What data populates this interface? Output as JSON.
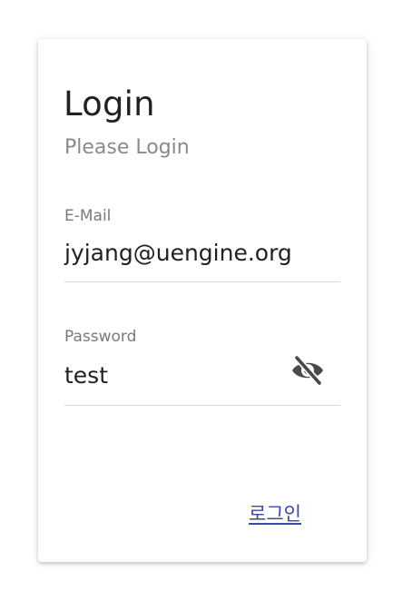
{
  "header": {
    "title": "Login",
    "subtitle": "Please Login"
  },
  "form": {
    "email": {
      "label": "E-Mail",
      "value": "jyjang@uengine.org"
    },
    "password": {
      "label": "Password",
      "value": "test",
      "toggle_icon": "eye-off-icon"
    },
    "login_label": "로그인"
  },
  "colors": {
    "link": "#3949ab",
    "label": "#7a7a7a",
    "subtitle": "#8a8a8a",
    "divider": "#d6d6d6"
  }
}
